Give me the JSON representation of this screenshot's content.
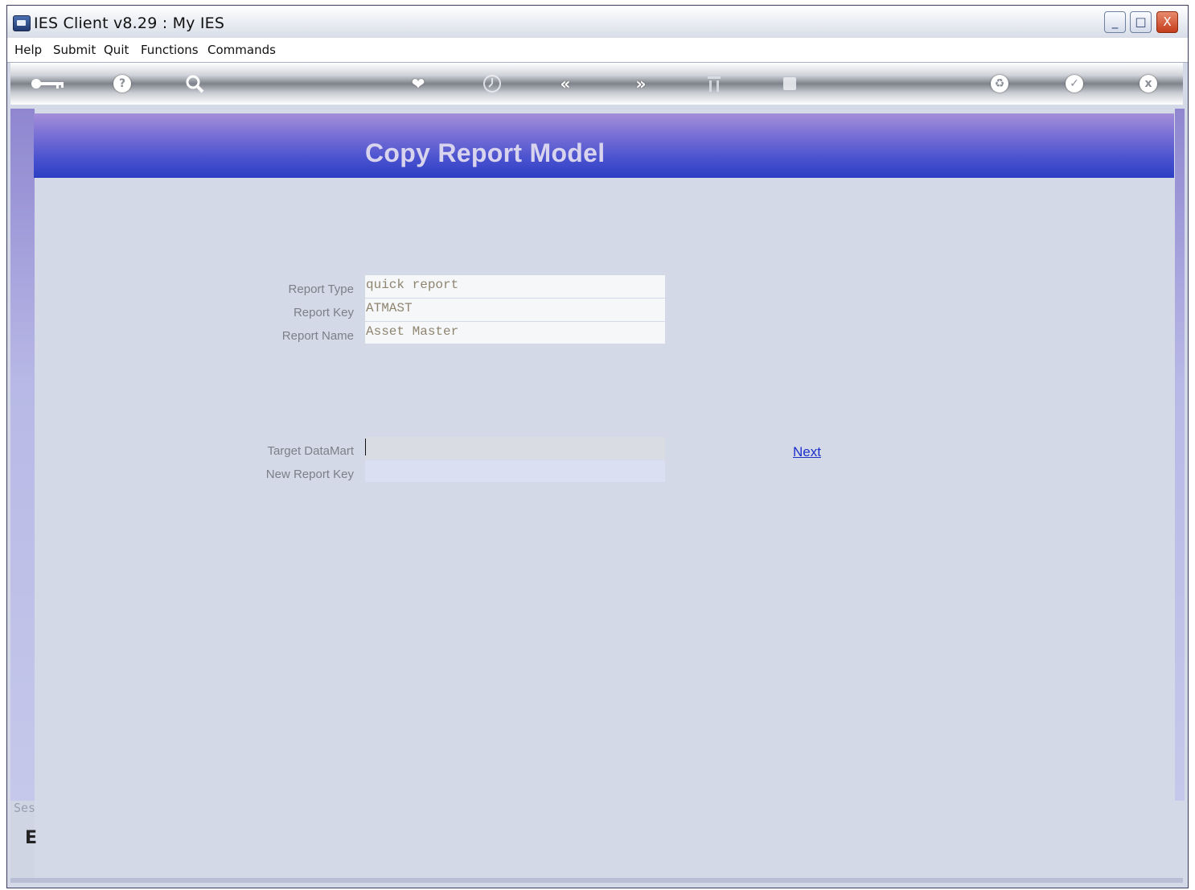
{
  "window": {
    "title": "IES Client v8.29 : My IES",
    "controls": [
      "_",
      "□",
      "X"
    ]
  },
  "menubar": {
    "items": [
      "Help",
      "Submit",
      "Quit",
      "Functions",
      "Commands"
    ]
  },
  "toolbar": {
    "buttons": [
      {
        "icon": "key-icon"
      },
      {
        "icon": "help-icon"
      },
      {
        "icon": "search-icon"
      },
      {
        "icon": "heart-icon"
      },
      {
        "icon": "clock-icon"
      },
      {
        "icon": "rewind-icon"
      },
      {
        "icon": "fast-forward-icon"
      },
      {
        "icon": "columns-icon"
      },
      {
        "icon": "square-icon"
      },
      {
        "icon": "recycle-icon"
      },
      {
        "icon": "check-icon"
      },
      {
        "icon": "close-icon"
      }
    ]
  },
  "sidebar": {
    "text_top": "Ses",
    "text_bottom": "E"
  },
  "page": {
    "title": "Copy Report Model",
    "source": {
      "report_type_label": "Report Type",
      "report_type_value": "quick report",
      "report_key_label": "Report Key",
      "report_key_value": "ATMAST",
      "report_name_label": "Report Name",
      "report_name_value": "Asset Master"
    },
    "target": {
      "datamart_label": "Target DataMart",
      "datamart_value": "",
      "new_key_label": "New Report Key",
      "new_key_value": ""
    },
    "next_link": "Next"
  },
  "colors": {
    "header_band_top": "#a48ed8",
    "header_band_bottom": "#2b3fc4",
    "page_background": "#d3d9e6",
    "link": "#1b2fc9"
  }
}
